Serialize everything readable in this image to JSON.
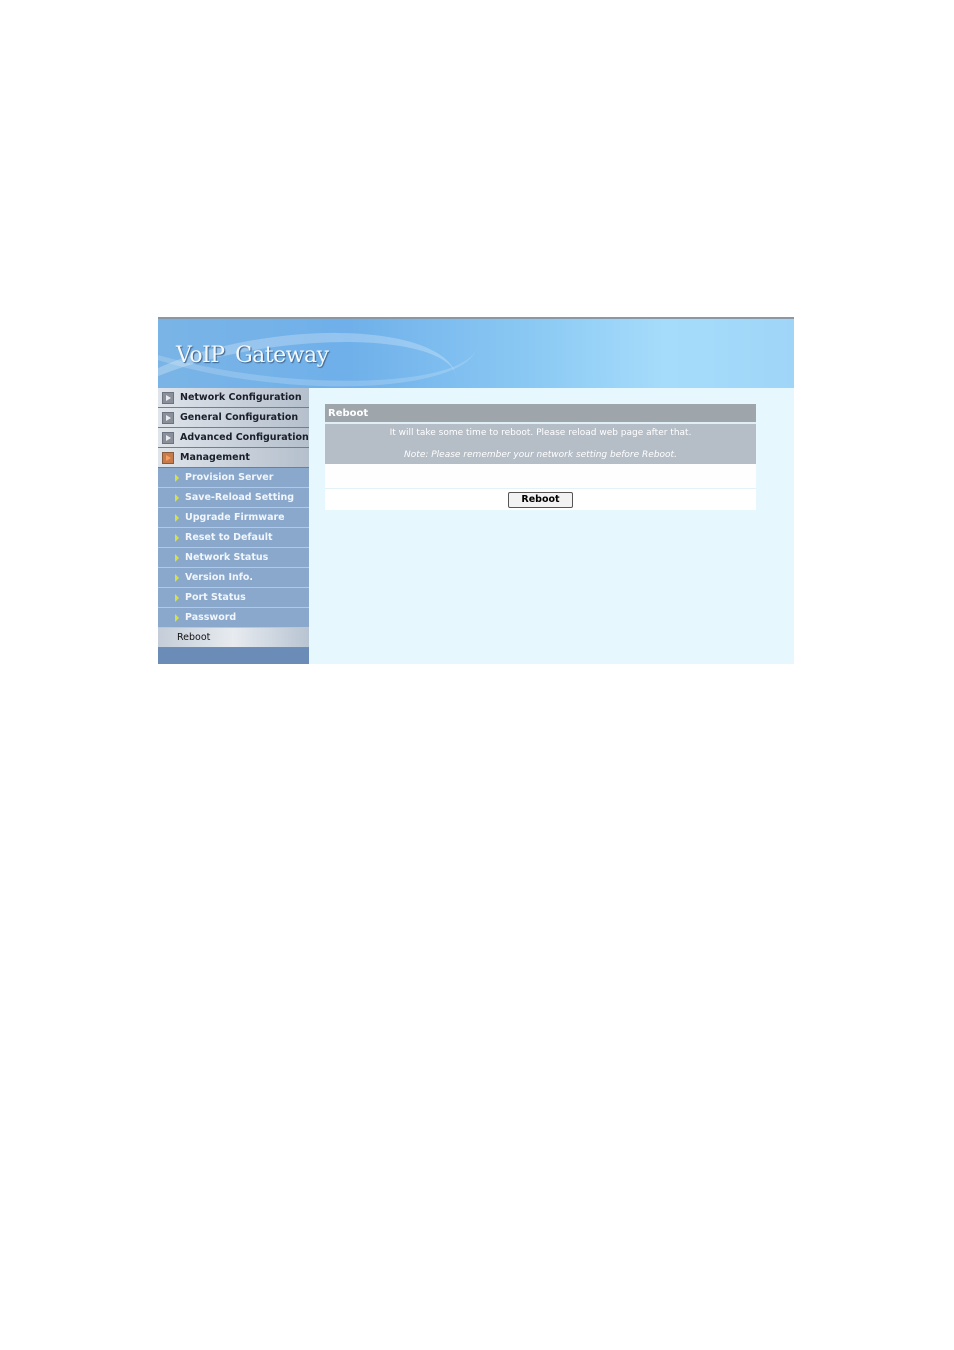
{
  "banner": {
    "title": "VoIP  Gateway"
  },
  "sidebar": {
    "top_items": [
      {
        "label": "Network Configuration",
        "icon": "expand-arrow-icon",
        "expanded": false
      },
      {
        "label": "General Configuration",
        "icon": "expand-arrow-icon",
        "expanded": false
      },
      {
        "label": "Advanced Configuration",
        "icon": "expand-arrow-icon",
        "expanded": false
      },
      {
        "label": "Management",
        "icon": "expand-arrow-icon",
        "expanded": true
      }
    ],
    "sub_items": [
      {
        "label": "Provision Server"
      },
      {
        "label": "Save-Reload Setting"
      },
      {
        "label": "Upgrade Firmware"
      },
      {
        "label": "Reset to Default"
      },
      {
        "label": "Network Status"
      },
      {
        "label": "Version Info."
      },
      {
        "label": "Port Status"
      },
      {
        "label": "Password"
      }
    ],
    "active_item": {
      "label": "Reboot"
    }
  },
  "panel": {
    "title": "Reboot",
    "message": "It will take some time to reboot. Please reload web page after that.",
    "note": "Note: Please remember your network setting before Reboot.",
    "button_label": "Reboot"
  },
  "colors": {
    "content_bg": "#e6f8fd",
    "panel_header_bg": "#9ea5ab",
    "panel_msg_bg": "#b5bdc7",
    "sub_nav_bg": "#8aa8cc"
  }
}
